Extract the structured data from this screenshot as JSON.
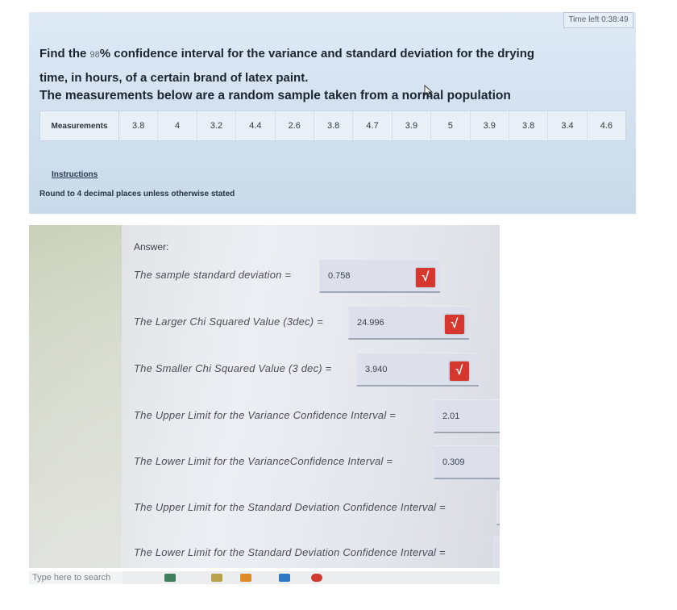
{
  "question": {
    "timer": "Time left 0:38:49",
    "line1_prefix": "Find the ",
    "confidence_pct": "98",
    "line1_suffix": "% confidence interval for the variance and standard deviation for the drying",
    "line2": "time, in hours,  of a certain brand of latex paint.",
    "line3": "The measurements below are a random sample taken from a normal population",
    "table": {
      "header": "Measurements",
      "values": [
        "3.8",
        "4",
        "3.2",
        "4.4",
        "2.6",
        "3.8",
        "4.7",
        "3.9",
        "5",
        "3.9",
        "3.8",
        "3.4",
        "4.6"
      ]
    },
    "instructions_link": "Instructions",
    "round_note": "Round to 4 decimal places unless otherwise stated"
  },
  "answer": {
    "title": "Answer:",
    "rows": [
      {
        "label": "The sample standard deviation  =",
        "value": "0.758",
        "checked": true
      },
      {
        "label": "The Larger Chi Squared Value (3dec)  =",
        "value": "24.996",
        "checked": true
      },
      {
        "label": "The Smaller Chi Squared Value (3 dec)  =",
        "value": "3.940",
        "checked": true
      },
      {
        "label": "The Upper Limit for the Variance Confidence Interval =",
        "value": "2.01",
        "checked": false
      },
      {
        "label": "The Lower Limit for the VarianceConfidence Interval =",
        "value": "0.309",
        "checked": false
      },
      {
        "label": "The Upper Limit for the Standard Deviation  Confidence Interval =",
        "value": "",
        "checked": false
      },
      {
        "label": "The Lower Limit for the Standard Deviation Confidence Interval =",
        "value": "",
        "checked": false
      }
    ]
  },
  "taskbar": {
    "search_placeholder": "Type here to search"
  },
  "colors": {
    "check_badge": "#d5362d",
    "question_panel": "#d4e2f0"
  }
}
